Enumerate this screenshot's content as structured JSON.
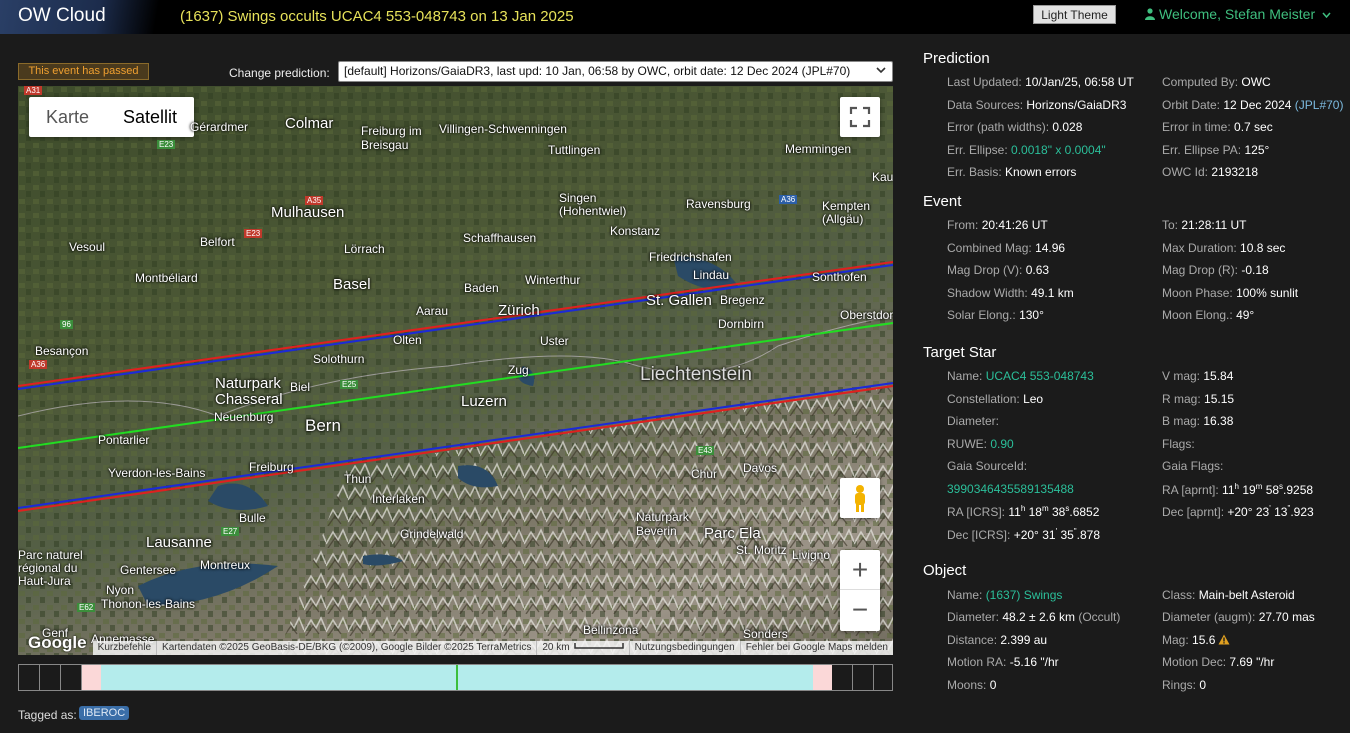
{
  "header": {
    "brand": "OW Cloud",
    "title": "(1637) Swings occults UCAC4 553-048743 on 13 Jan 2025",
    "theme_button": "Light Theme",
    "welcome": "Welcome, Stefan Meister"
  },
  "controls": {
    "passed_badge": "This event has passed",
    "change_label": "Change prediction:",
    "prediction_select": "[default] Horizons/GaiaDR3, last upd: 10 Jan, 06:58 by OWC, orbit date: 12 Dec 2024 (JPL#70)"
  },
  "map": {
    "type_map": "Karte",
    "type_satellite": "Satellit",
    "zoom_in": "+",
    "zoom_out": "−",
    "google": "Google",
    "attribution": {
      "shortcuts": "Kurzbefehle",
      "data": "Kartendaten ©2025 GeoBasis-DE/BKG (©2009), Google Bilder ©2025 TerraMetrics",
      "scale": "20 km",
      "terms": "Nutzungsbedingungen",
      "report": "Fehler bei Google Maps melden"
    },
    "places": [
      "Colmar",
      "Gérardmer",
      "Freiburg im Breisgau",
      "Villingen-Schwenningen",
      "Tuttlingen",
      "Memmingen",
      "Singen (Hohentwiel)",
      "Ravensburg",
      "Kempten (Allgäu)",
      "Mulhausen",
      "Vesoul",
      "Belfort",
      "Lörrach",
      "Schaffhausen",
      "Konstanz",
      "Friedrichshafen",
      "Lindau",
      "Sonthofen",
      "Montbéliard",
      "Basel",
      "Winterthur",
      "Baden",
      "Zürich",
      "St. Gallen",
      "Bregenz",
      "Dornbirn",
      "Aarau",
      "Olten",
      "Uster",
      "Oberstdorf",
      "Besançon",
      "Solothurn",
      "Zug",
      "Liechtenstein",
      "Naturpark Chasseral",
      "Biel",
      "Neuenburg",
      "Bern",
      "Luzern",
      "Pontarlier",
      "Yverdon-les-Bains",
      "Freiburg",
      "Thun",
      "Interlaken",
      "Chur",
      "Davos",
      "Bulle",
      "Grindelwald",
      "Naturpark Beverin",
      "Parc Ela",
      "St. Moritz",
      "Livigno",
      "Lausanne",
      "Gentersee",
      "Montreux",
      "Nyon",
      "Thonon-les-Bains",
      "Parc naturel régional du Haut-Jura",
      "Bellinzona",
      "Sonders",
      "Genf",
      "Annemasse",
      "Kau"
    ],
    "shields": [
      "A31",
      "E23",
      "A35",
      "A36",
      "96",
      "E23",
      "A36",
      "E25",
      "E43",
      "E27",
      "E62"
    ],
    "colors": {
      "path_limit": "#1c2ad8",
      "error_limit": "#e0201f",
      "centerline": "#22dd22"
    }
  },
  "timeline": {
    "colors": {
      "error": "#fbd8d8",
      "path": "#b4ecec",
      "center": "#3cbf3c"
    }
  },
  "tags": {
    "label": "Tagged as:",
    "items": [
      "IBEROC"
    ]
  },
  "prediction": {
    "title": "Prediction",
    "left": [
      {
        "k": "Last Updated:",
        "v": "10/Jan/25, 06:58 UT"
      },
      {
        "k": "Data Sources:",
        "v": "Horizons/GaiaDR3"
      },
      {
        "k": "Error (path widths):",
        "v": "0.028"
      },
      {
        "k": "Err. Ellipse:",
        "v": "0.0018\" x 0.0004\""
      },
      {
        "k": "Err. Basis:",
        "v": "Known errors"
      }
    ],
    "right": [
      {
        "k": "Computed By:",
        "v": "OWC"
      },
      {
        "k": "Orbit Date:",
        "v": "12 Dec 2024",
        "extra": "(JPL#70)"
      },
      {
        "k": "Error in time:",
        "v": "0.7 sec"
      },
      {
        "k": "Err. Ellipse PA:",
        "v": "125°"
      },
      {
        "k": "OWC Id:",
        "v": "2193218"
      }
    ]
  },
  "event": {
    "title": "Event",
    "left": [
      {
        "k": "From:",
        "v": "20:41:26 UT"
      },
      {
        "k": "Combined Mag:",
        "v": "14.96"
      },
      {
        "k": "Mag Drop (V):",
        "v": "0.63"
      },
      {
        "k": "Shadow Width:",
        "v": "49.1 km"
      },
      {
        "k": "Solar Elong.:",
        "v": "130°"
      }
    ],
    "right": [
      {
        "k": "To:",
        "v": "21:28:11 UT"
      },
      {
        "k": "Max Duration:",
        "v": "10.8 sec"
      },
      {
        "k": "Mag Drop (R):",
        "v": "-0.18"
      },
      {
        "k": "Moon Phase:",
        "v": "100% sunlit"
      },
      {
        "k": "Moon Elong.:",
        "v": "49°"
      }
    ]
  },
  "target_star": {
    "title": "Target Star",
    "name_k": "Name:",
    "name_v": "UCAC4 553-048743",
    "constellation_k": "Constellation:",
    "constellation_v": "Leo",
    "diameter_k": "Diameter:",
    "ruwe_k": "RUWE:",
    "ruwe_v": "0.90",
    "gaia_k": "Gaia SourceId:",
    "gaia_v": "3990346435589135488",
    "ra_icrs_k": "RA [ICRS]:",
    "ra_icrs": {
      "h": "11",
      "m": "18",
      "s": "38",
      "f": ".6852"
    },
    "dec_icrs_k": "Dec [ICRS]:",
    "dec_icrs": {
      "d": "+20°",
      "m": "31",
      "s": "35",
      "f": ".878"
    },
    "vmag_k": "V mag:",
    "vmag_v": "15.84",
    "rmag_k": "R mag:",
    "rmag_v": "15.15",
    "bmag_k": "B mag:",
    "bmag_v": "16.38",
    "flags_k": "Flags:",
    "gaia_flags_k": "Gaia Flags:",
    "ra_aprnt_k": "RA [aprnt]:",
    "ra_aprnt": {
      "h": "11",
      "m": "19",
      "s": "58",
      "f": ".9258"
    },
    "dec_aprnt_k": "Dec [aprnt]:",
    "dec_aprnt": {
      "d": "+20°",
      "m": "23",
      "s": "13",
      "f": ".923"
    }
  },
  "object": {
    "title": "Object",
    "left": [
      {
        "k": "Name:",
        "v": "(1637) Swings"
      },
      {
        "k": "Diameter:",
        "v": "48.2 ± 2.6 km",
        "extra": "(Occult)"
      },
      {
        "k": "Distance:",
        "v": "2.399 au"
      },
      {
        "k": "Motion RA:",
        "v": "-5.16 \"/hr"
      },
      {
        "k": "Moons:",
        "v": "0"
      }
    ],
    "right": [
      {
        "k": "Class:",
        "v": "Main-belt Asteroid"
      },
      {
        "k": "Diameter (augm):",
        "v": "27.70 mas"
      },
      {
        "k": "Mag:",
        "v": "15.6"
      },
      {
        "k": "Motion Dec:",
        "v": "7.69 \"/hr"
      },
      {
        "k": "Rings:",
        "v": "0"
      }
    ]
  }
}
